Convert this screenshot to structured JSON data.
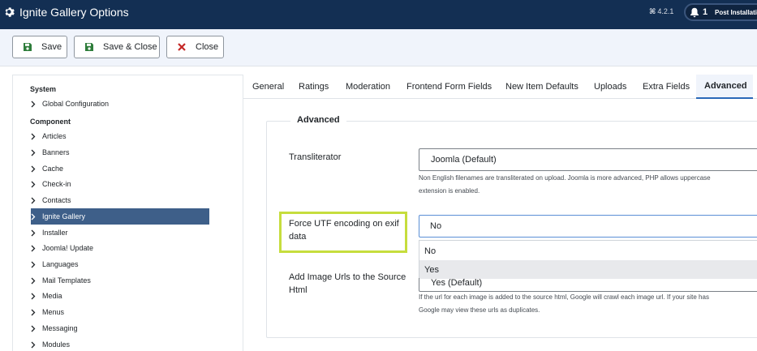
{
  "header": {
    "title": "Ignite Gallery Options",
    "version_symbol": "⌘",
    "version": "4.2.1",
    "notification_count": "1",
    "post_installation": "Post Installation"
  },
  "toolbar": {
    "save_label": "Save",
    "save_close_label": "Save & Close",
    "close_label": "Close"
  },
  "sidebar": {
    "system_heading": "System",
    "component_heading": "Component",
    "system_items": [
      "Global Configuration"
    ],
    "component_items": [
      "Articles",
      "Banners",
      "Cache",
      "Check-in",
      "Contacts",
      "Ignite Gallery",
      "Installer",
      "Joomla! Update",
      "Languages",
      "Mail Templates",
      "Media",
      "Menus",
      "Messaging",
      "Modules"
    ],
    "active_item": "Ignite Gallery"
  },
  "tabs": [
    "General",
    "Ratings",
    "Moderation",
    "Frontend Form Fields",
    "New Item Defaults",
    "Uploads",
    "Extra Fields",
    "Advanced"
  ],
  "active_tab": "Advanced",
  "advanced": {
    "legend": "Advanced",
    "transliterator": {
      "label": "Transliterator",
      "value": "Joomla (Default)",
      "help_line1": "Non English filenames are transliterated on upload. Joomla is more advanced, PHP allows uppercase",
      "help_line2": "extension is enabled."
    },
    "force_utf": {
      "label_line1": "Force UTF encoding on exif",
      "label_line2": "data",
      "value": "No",
      "options": [
        "No",
        "Yes"
      ],
      "highlighted_option": "Yes"
    },
    "image_urls": {
      "label_line1": "Add Image Urls to the Source",
      "label_line2": "Html",
      "value": "Yes (Default)",
      "help_line1": "If the url for each image is added to the source html, Google will crawl each image url. If your site has",
      "help_line2": "Google may view these urls as duplicates."
    }
  },
  "colors": {
    "header_bg": "#132f53",
    "toolbar_bg": "#f0f4fb",
    "active_sidebar": "#3e5f89",
    "focus_highlight": "#c6dd3d",
    "save_icon": "#2e7d3b",
    "close_icon": "#c52827"
  }
}
